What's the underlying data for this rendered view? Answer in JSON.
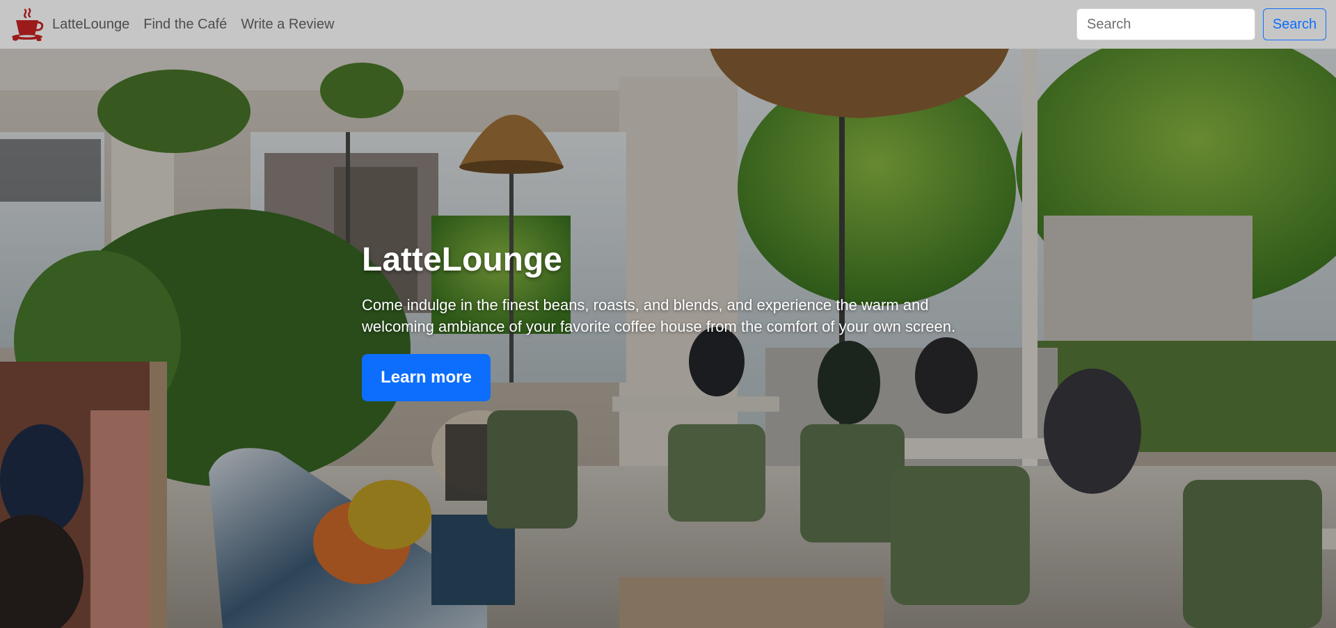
{
  "navbar": {
    "brand": {
      "name": "LatteLounge",
      "logo_icon": "coffee-cup-icon"
    },
    "links": [
      {
        "label": "Find the Café"
      },
      {
        "label": "Write a Review"
      }
    ],
    "search": {
      "placeholder": "Search",
      "value": "",
      "button_label": "Search"
    }
  },
  "hero": {
    "background": "cafe-interior-photo",
    "title": "LatteLounge",
    "text": "Come indulge in the finest beans, roasts, and blends, and experience the warm and welcoming ambiance of your favorite coffee house from the comfort of your own screen.",
    "button_label": "Learn more"
  },
  "colors": {
    "navbar_bg": "#c6c6c6",
    "primary": "#0d6efd",
    "logo": "#9b1b1b"
  }
}
